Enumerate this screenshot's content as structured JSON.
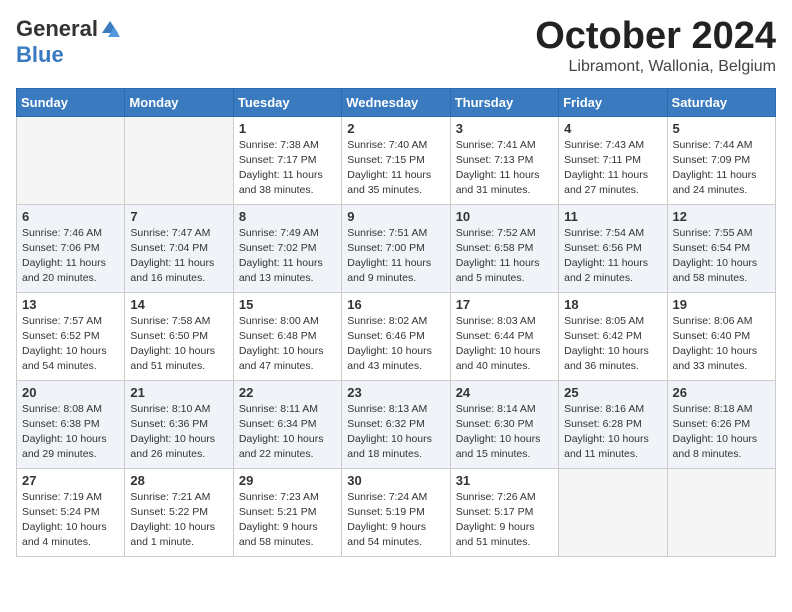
{
  "header": {
    "logo_general": "General",
    "logo_blue": "Blue",
    "month": "October 2024",
    "location": "Libramont, Wallonia, Belgium"
  },
  "days_of_week": [
    "Sunday",
    "Monday",
    "Tuesday",
    "Wednesday",
    "Thursday",
    "Friday",
    "Saturday"
  ],
  "weeks": [
    [
      {
        "day": "",
        "empty": true
      },
      {
        "day": "",
        "empty": true
      },
      {
        "day": "1",
        "sunrise": "Sunrise: 7:38 AM",
        "sunset": "Sunset: 7:17 PM",
        "daylight": "Daylight: 11 hours and 38 minutes."
      },
      {
        "day": "2",
        "sunrise": "Sunrise: 7:40 AM",
        "sunset": "Sunset: 7:15 PM",
        "daylight": "Daylight: 11 hours and 35 minutes."
      },
      {
        "day": "3",
        "sunrise": "Sunrise: 7:41 AM",
        "sunset": "Sunset: 7:13 PM",
        "daylight": "Daylight: 11 hours and 31 minutes."
      },
      {
        "day": "4",
        "sunrise": "Sunrise: 7:43 AM",
        "sunset": "Sunset: 7:11 PM",
        "daylight": "Daylight: 11 hours and 27 minutes."
      },
      {
        "day": "5",
        "sunrise": "Sunrise: 7:44 AM",
        "sunset": "Sunset: 7:09 PM",
        "daylight": "Daylight: 11 hours and 24 minutes."
      }
    ],
    [
      {
        "day": "6",
        "sunrise": "Sunrise: 7:46 AM",
        "sunset": "Sunset: 7:06 PM",
        "daylight": "Daylight: 11 hours and 20 minutes."
      },
      {
        "day": "7",
        "sunrise": "Sunrise: 7:47 AM",
        "sunset": "Sunset: 7:04 PM",
        "daylight": "Daylight: 11 hours and 16 minutes."
      },
      {
        "day": "8",
        "sunrise": "Sunrise: 7:49 AM",
        "sunset": "Sunset: 7:02 PM",
        "daylight": "Daylight: 11 hours and 13 minutes."
      },
      {
        "day": "9",
        "sunrise": "Sunrise: 7:51 AM",
        "sunset": "Sunset: 7:00 PM",
        "daylight": "Daylight: 11 hours and 9 minutes."
      },
      {
        "day": "10",
        "sunrise": "Sunrise: 7:52 AM",
        "sunset": "Sunset: 6:58 PM",
        "daylight": "Daylight: 11 hours and 5 minutes."
      },
      {
        "day": "11",
        "sunrise": "Sunrise: 7:54 AM",
        "sunset": "Sunset: 6:56 PM",
        "daylight": "Daylight: 11 hours and 2 minutes."
      },
      {
        "day": "12",
        "sunrise": "Sunrise: 7:55 AM",
        "sunset": "Sunset: 6:54 PM",
        "daylight": "Daylight: 10 hours and 58 minutes."
      }
    ],
    [
      {
        "day": "13",
        "sunrise": "Sunrise: 7:57 AM",
        "sunset": "Sunset: 6:52 PM",
        "daylight": "Daylight: 10 hours and 54 minutes."
      },
      {
        "day": "14",
        "sunrise": "Sunrise: 7:58 AM",
        "sunset": "Sunset: 6:50 PM",
        "daylight": "Daylight: 10 hours and 51 minutes."
      },
      {
        "day": "15",
        "sunrise": "Sunrise: 8:00 AM",
        "sunset": "Sunset: 6:48 PM",
        "daylight": "Daylight: 10 hours and 47 minutes."
      },
      {
        "day": "16",
        "sunrise": "Sunrise: 8:02 AM",
        "sunset": "Sunset: 6:46 PM",
        "daylight": "Daylight: 10 hours and 43 minutes."
      },
      {
        "day": "17",
        "sunrise": "Sunrise: 8:03 AM",
        "sunset": "Sunset: 6:44 PM",
        "daylight": "Daylight: 10 hours and 40 minutes."
      },
      {
        "day": "18",
        "sunrise": "Sunrise: 8:05 AM",
        "sunset": "Sunset: 6:42 PM",
        "daylight": "Daylight: 10 hours and 36 minutes."
      },
      {
        "day": "19",
        "sunrise": "Sunrise: 8:06 AM",
        "sunset": "Sunset: 6:40 PM",
        "daylight": "Daylight: 10 hours and 33 minutes."
      }
    ],
    [
      {
        "day": "20",
        "sunrise": "Sunrise: 8:08 AM",
        "sunset": "Sunset: 6:38 PM",
        "daylight": "Daylight: 10 hours and 29 minutes."
      },
      {
        "day": "21",
        "sunrise": "Sunrise: 8:10 AM",
        "sunset": "Sunset: 6:36 PM",
        "daylight": "Daylight: 10 hours and 26 minutes."
      },
      {
        "day": "22",
        "sunrise": "Sunrise: 8:11 AM",
        "sunset": "Sunset: 6:34 PM",
        "daylight": "Daylight: 10 hours and 22 minutes."
      },
      {
        "day": "23",
        "sunrise": "Sunrise: 8:13 AM",
        "sunset": "Sunset: 6:32 PM",
        "daylight": "Daylight: 10 hours and 18 minutes."
      },
      {
        "day": "24",
        "sunrise": "Sunrise: 8:14 AM",
        "sunset": "Sunset: 6:30 PM",
        "daylight": "Daylight: 10 hours and 15 minutes."
      },
      {
        "day": "25",
        "sunrise": "Sunrise: 8:16 AM",
        "sunset": "Sunset: 6:28 PM",
        "daylight": "Daylight: 10 hours and 11 minutes."
      },
      {
        "day": "26",
        "sunrise": "Sunrise: 8:18 AM",
        "sunset": "Sunset: 6:26 PM",
        "daylight": "Daylight: 10 hours and 8 minutes."
      }
    ],
    [
      {
        "day": "27",
        "sunrise": "Sunrise: 7:19 AM",
        "sunset": "Sunset: 5:24 PM",
        "daylight": "Daylight: 10 hours and 4 minutes."
      },
      {
        "day": "28",
        "sunrise": "Sunrise: 7:21 AM",
        "sunset": "Sunset: 5:22 PM",
        "daylight": "Daylight: 10 hours and 1 minute."
      },
      {
        "day": "29",
        "sunrise": "Sunrise: 7:23 AM",
        "sunset": "Sunset: 5:21 PM",
        "daylight": "Daylight: 9 hours and 58 minutes."
      },
      {
        "day": "30",
        "sunrise": "Sunrise: 7:24 AM",
        "sunset": "Sunset: 5:19 PM",
        "daylight": "Daylight: 9 hours and 54 minutes."
      },
      {
        "day": "31",
        "sunrise": "Sunrise: 7:26 AM",
        "sunset": "Sunset: 5:17 PM",
        "daylight": "Daylight: 9 hours and 51 minutes."
      },
      {
        "day": "",
        "empty": true
      },
      {
        "day": "",
        "empty": true
      }
    ]
  ]
}
